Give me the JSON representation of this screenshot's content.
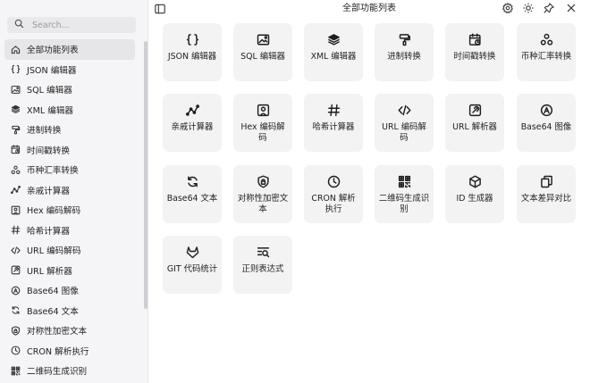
{
  "window": {
    "title": "全部功能列表"
  },
  "search": {
    "placeholder": "Search..."
  },
  "sidebar": {
    "items": [
      {
        "label": "全部功能列表",
        "icon": "home-icon",
        "active": true
      },
      {
        "label": "JSON 编辑器",
        "icon": "braces-icon"
      },
      {
        "label": "SQL 编辑器",
        "icon": "image-editor-icon"
      },
      {
        "label": "XML 编辑器",
        "icon": "layers-icon"
      },
      {
        "label": "进制转换",
        "icon": "paint-roller-icon"
      },
      {
        "label": "时间戳转换",
        "icon": "calendar-clock-icon"
      },
      {
        "label": "币种汇率转换",
        "icon": "currency-triangle-icon"
      },
      {
        "label": "亲戚计算器",
        "icon": "network-line-icon"
      },
      {
        "label": "Hex 编码解码",
        "icon": "image-lock-icon"
      },
      {
        "label": "哈希计算器",
        "icon": "hash-icon"
      },
      {
        "label": "URL 编码解码",
        "icon": "code-icon"
      },
      {
        "label": "URL 解析器",
        "icon": "link-square-icon"
      },
      {
        "label": "Base64 图像",
        "icon": "base64-image-icon"
      },
      {
        "label": "Base64 文本",
        "icon": "refresh-icon"
      },
      {
        "label": "对称性加密文本",
        "icon": "shield-lock-icon"
      },
      {
        "label": "CRON 解析执行",
        "icon": "clock-icon"
      },
      {
        "label": "二维码生成识别",
        "icon": "qr-code-icon"
      }
    ]
  },
  "tools": [
    {
      "label": "JSON 编辑器",
      "icon": "braces-icon"
    },
    {
      "label": "SQL 编辑器",
      "icon": "image-editor-icon"
    },
    {
      "label": "XML 编辑器",
      "icon": "layers-icon"
    },
    {
      "label": "进制转换",
      "icon": "paint-roller-icon"
    },
    {
      "label": "时间戳转换",
      "icon": "calendar-clock-icon"
    },
    {
      "label": "币种汇率转换",
      "icon": "currency-triangle-icon"
    },
    {
      "label": "亲戚计算器",
      "icon": "network-line-icon"
    },
    {
      "label": "Hex 编码解码",
      "icon": "image-lock-icon"
    },
    {
      "label": "哈希计算器",
      "icon": "hash-icon"
    },
    {
      "label": "URL 编码解码",
      "icon": "code-icon"
    },
    {
      "label": "URL 解析器",
      "icon": "link-square-icon"
    },
    {
      "label": "Base64 图像",
      "icon": "base64-image-icon"
    },
    {
      "label": "Base64 文本",
      "icon": "refresh-icon"
    },
    {
      "label": "对称性加密文本",
      "icon": "shield-lock-icon"
    },
    {
      "label": "CRON 解析执行",
      "icon": "clock-icon"
    },
    {
      "label": "二维码生成识别",
      "icon": "qr-code-icon"
    },
    {
      "label": "ID 生成器",
      "icon": "cube-icon"
    },
    {
      "label": "文本差异对比",
      "icon": "copy-icon"
    },
    {
      "label": "GIT 代码统计",
      "icon": "gitlab-icon"
    },
    {
      "label": "正则表达式",
      "icon": "regex-search-icon"
    }
  ],
  "toolbar": {
    "buttons": [
      "settings-icon",
      "theme-icon",
      "pin-icon",
      "close-icon"
    ]
  },
  "colors": {
    "sidebar_bg": "#f5f5f7",
    "card_bg": "#f3f3f4",
    "active_item_bg": "#e6e6e9",
    "text": "#222222"
  }
}
